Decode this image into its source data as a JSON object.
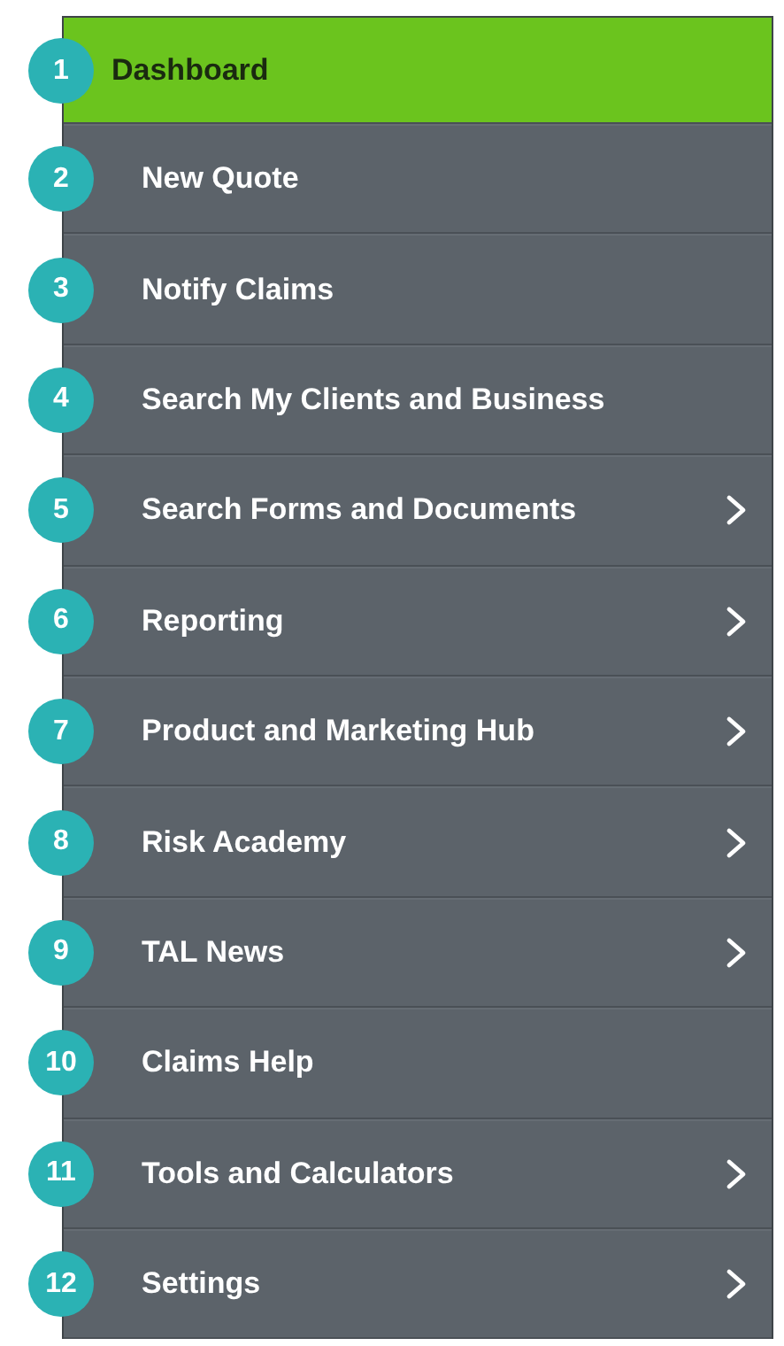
{
  "menu": {
    "items": [
      {
        "number": "1",
        "label": "Dashboard",
        "selected": true,
        "has_submenu": false
      },
      {
        "number": "2",
        "label": "New Quote",
        "selected": false,
        "has_submenu": false
      },
      {
        "number": "3",
        "label": "Notify Claims",
        "selected": false,
        "has_submenu": false
      },
      {
        "number": "4",
        "label": "Search My Clients and Business",
        "selected": false,
        "has_submenu": false
      },
      {
        "number": "5",
        "label": "Search Forms and Documents",
        "selected": false,
        "has_submenu": true
      },
      {
        "number": "6",
        "label": "Reporting",
        "selected": false,
        "has_submenu": true
      },
      {
        "number": "7",
        "label": "Product and Marketing Hub",
        "selected": false,
        "has_submenu": true
      },
      {
        "number": "8",
        "label": "Risk Academy",
        "selected": false,
        "has_submenu": true
      },
      {
        "number": "9",
        "label": "TAL News",
        "selected": false,
        "has_submenu": true
      },
      {
        "number": "10",
        "label": "Claims Help",
        "selected": false,
        "has_submenu": false
      },
      {
        "number": "11",
        "label": "Tools and Calculators",
        "selected": false,
        "has_submenu": true
      },
      {
        "number": "12",
        "label": "Settings",
        "selected": false,
        "has_submenu": true
      }
    ]
  }
}
